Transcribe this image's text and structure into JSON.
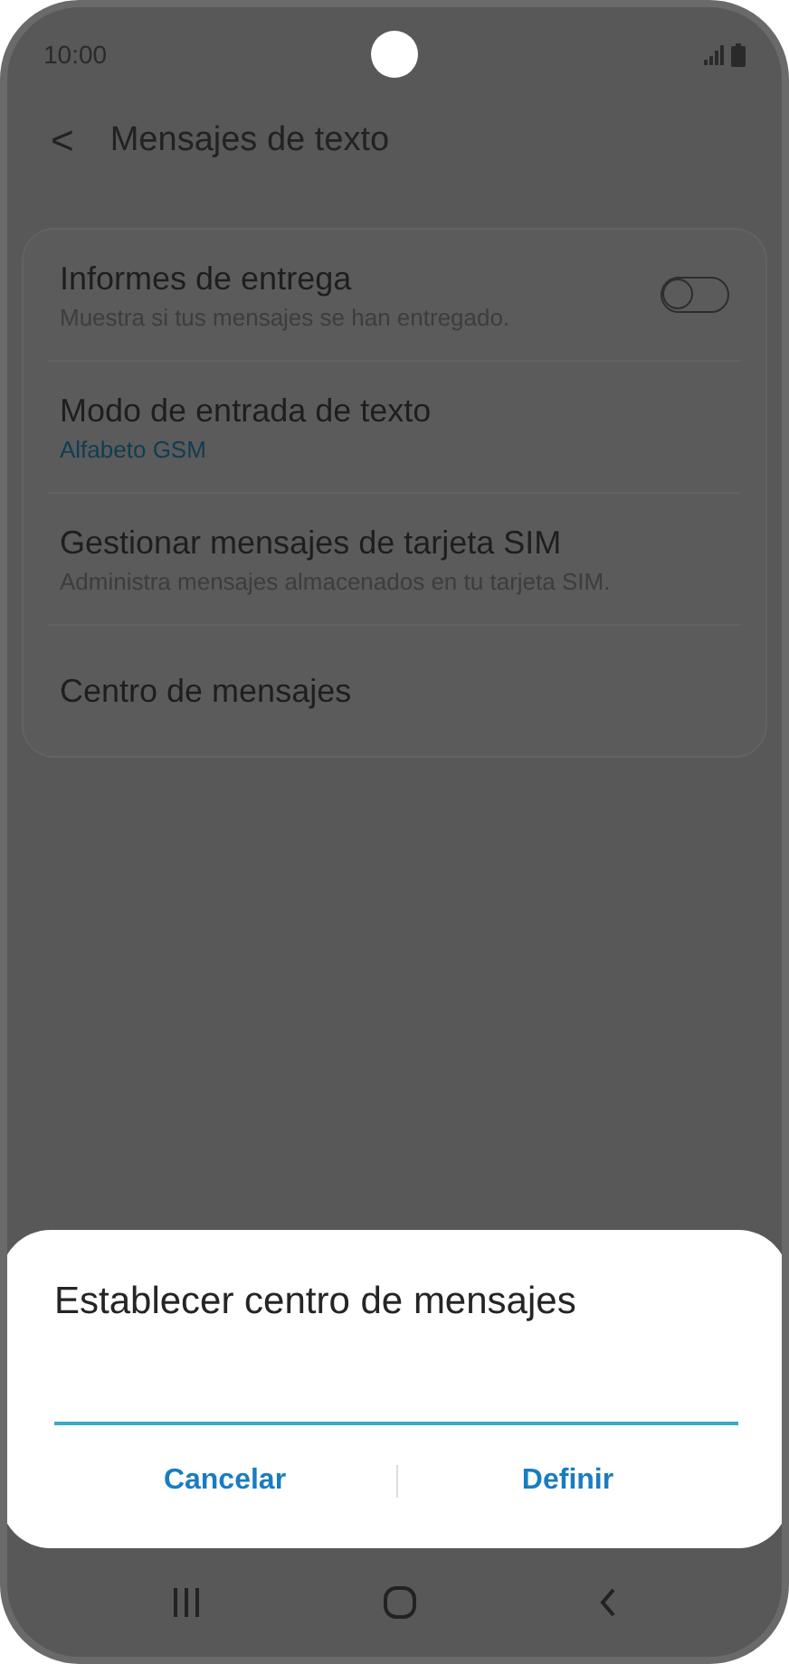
{
  "status_bar": {
    "time": "10:00"
  },
  "header": {
    "back": "<",
    "title": "Mensajes de texto"
  },
  "settings": [
    {
      "kind": "toggle",
      "title": "Informes de entrega",
      "subtitle": "Muestra si tus mensajes se han entregado.",
      "on": false
    },
    {
      "kind": "value",
      "title": "Modo de entrada de texto",
      "value": "Alfabeto GSM"
    },
    {
      "kind": "plain",
      "title": "Gestionar mensajes de tarjeta SIM",
      "subtitle": "Administra mensajes almacenados en tu tarjeta SIM."
    },
    {
      "kind": "plain",
      "title": "Centro de mensajes"
    }
  ],
  "dialog": {
    "title": "Establecer centro de mensajes",
    "buttons": [
      "Cancelar",
      "Definir"
    ]
  }
}
